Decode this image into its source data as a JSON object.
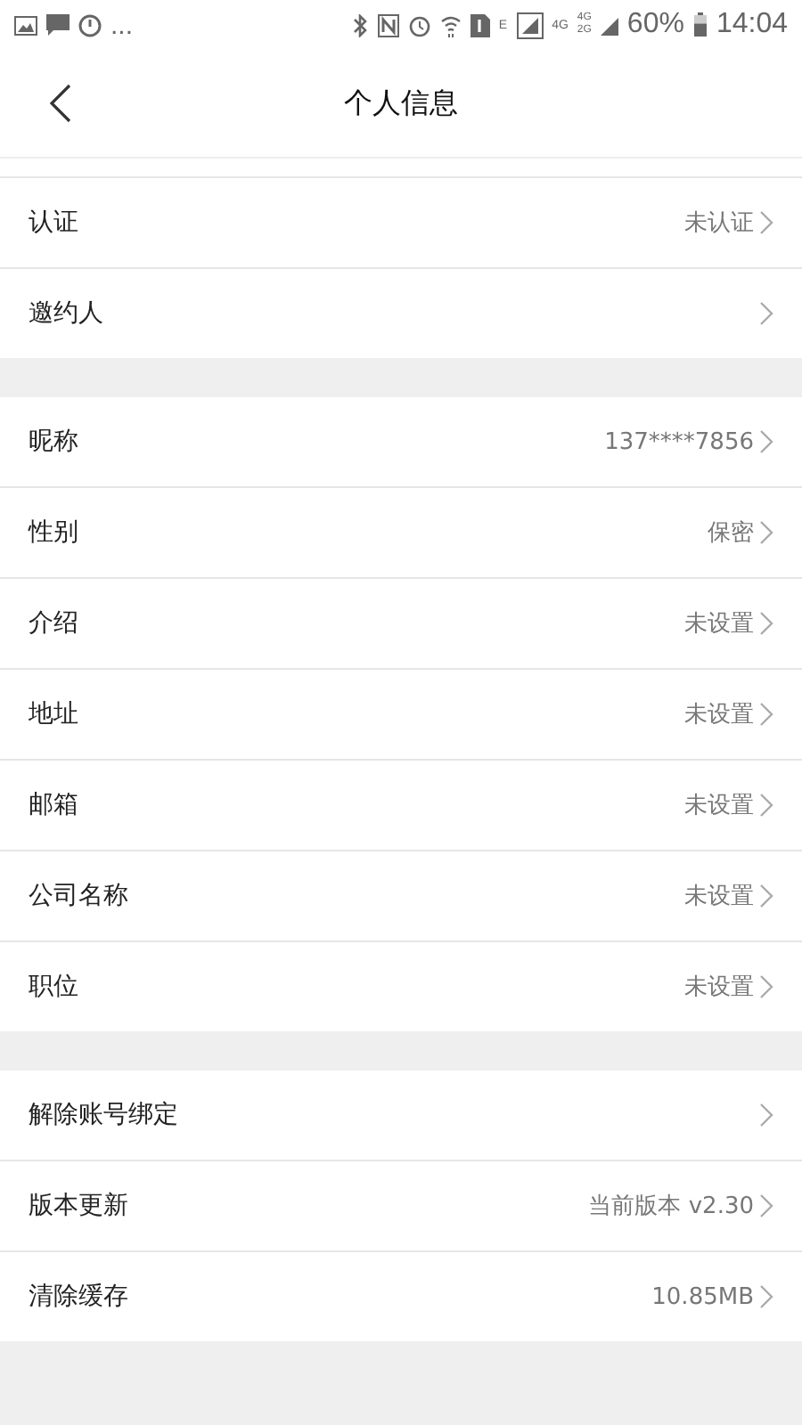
{
  "status_bar": {
    "overflow": "...",
    "network_e": "E",
    "network_4g": "4G",
    "network_dual_top": "4G",
    "network_dual_bottom": "2G",
    "battery": "60%",
    "time": "14:04"
  },
  "header": {
    "title": "个人信息"
  },
  "groups": [
    {
      "rows": [
        {
          "label": "认证",
          "value": "未认证"
        },
        {
          "label": "邀约人"
        }
      ]
    },
    {
      "rows": [
        {
          "label": "昵称",
          "value": "137****7856"
        },
        {
          "label": "性别",
          "value": "保密"
        },
        {
          "label": "介绍",
          "value": "未设置"
        },
        {
          "label": "地址",
          "value": "未设置"
        },
        {
          "label": "邮箱",
          "value": "未设置"
        },
        {
          "label": "公司名称",
          "value": "未设置"
        },
        {
          "label": "职位",
          "value": "未设置"
        }
      ]
    },
    {
      "rows": [
        {
          "label": "解除账号绑定"
        },
        {
          "label": "版本更新",
          "value": "当前版本 v2.30"
        },
        {
          "label": "清除缓存",
          "value": "10.85MB"
        }
      ]
    }
  ]
}
